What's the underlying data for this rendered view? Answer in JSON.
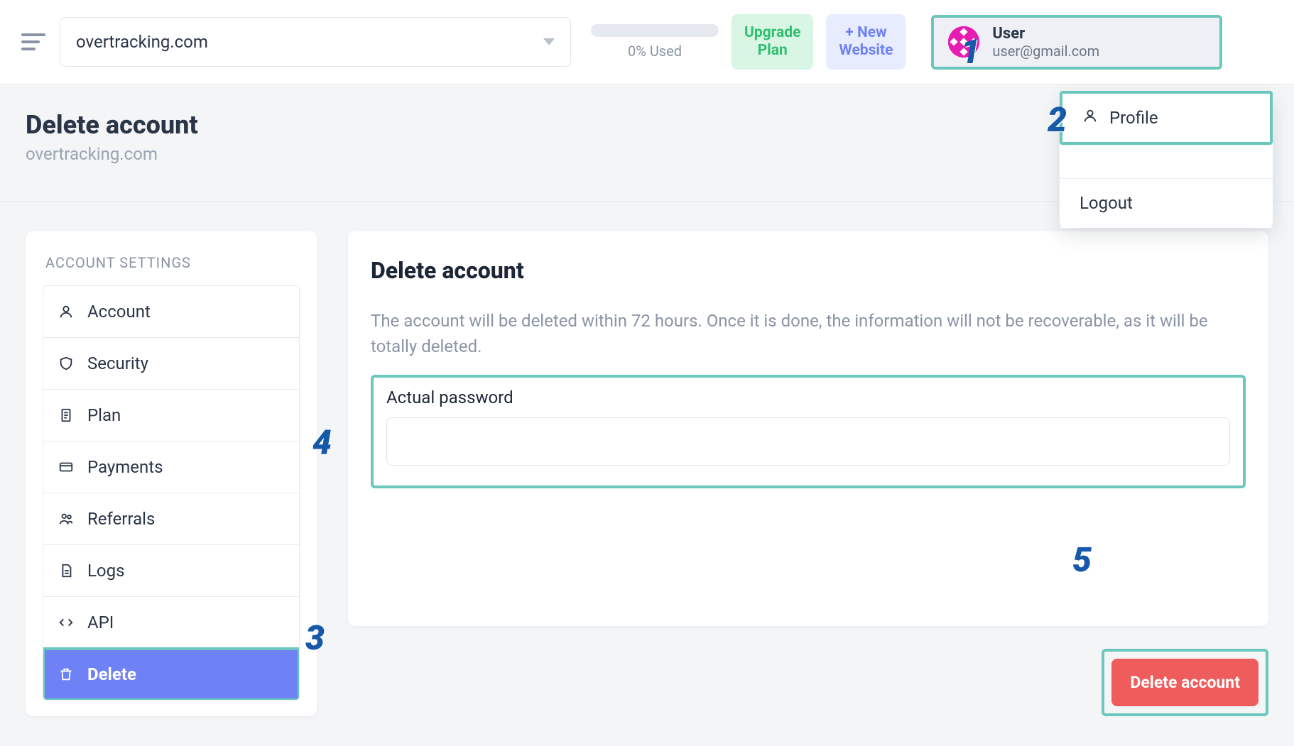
{
  "header": {
    "site_selector": "overtracking.com",
    "usage_text": "0% Used",
    "upgrade_line1": "Upgrade",
    "upgrade_line2": "Plan",
    "add_line1": "+ New",
    "add_line2": "Website",
    "user_name": "User",
    "user_email": "user@gmail.com"
  },
  "user_menu": {
    "profile": "Profile",
    "logout": "Logout"
  },
  "page": {
    "title": "Delete account",
    "subtitle": "overtracking.com"
  },
  "sidebar": {
    "section_label": "ACCOUNT SETTINGS",
    "items": [
      {
        "label": "Account"
      },
      {
        "label": "Security"
      },
      {
        "label": "Plan"
      },
      {
        "label": "Payments"
      },
      {
        "label": "Referrals"
      },
      {
        "label": "Logs"
      },
      {
        "label": "API"
      },
      {
        "label": "Delete"
      }
    ]
  },
  "main": {
    "heading": "Delete account",
    "description": "The account will be deleted within 72 hours. Once it is done, the information will not be recoverable, as it will be totally deleted.",
    "password_label": "Actual password",
    "password_placeholder": "",
    "delete_button": "Delete account"
  },
  "annotations": {
    "a1": "1",
    "a2": "2",
    "a3": "3",
    "a4": "4",
    "a5": "5"
  }
}
